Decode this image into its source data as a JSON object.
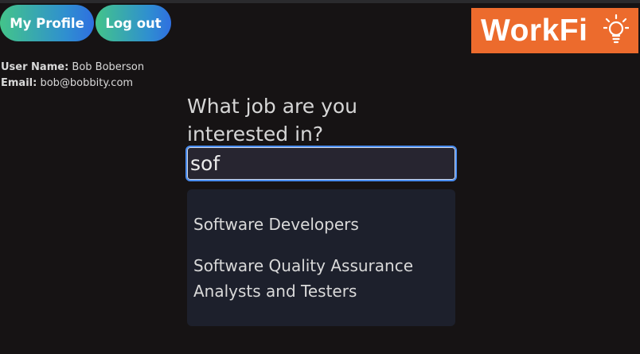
{
  "header": {
    "profile_button": "My Profile",
    "logout_button": "Log out",
    "logo_text": "WorkFi",
    "logo_color": "#ec6b2d"
  },
  "user": {
    "name_label": "User Name:",
    "name": "Bob Boberson",
    "email_label": "Email:",
    "email": "bob@bobbity.com"
  },
  "search": {
    "question": "What job are you interested in?",
    "value": "sof",
    "accent_color": "#4a8df0"
  },
  "results": [
    {
      "label": "Software Developers"
    },
    {
      "label": "Software Quality Assurance Analysts and Testers"
    }
  ]
}
